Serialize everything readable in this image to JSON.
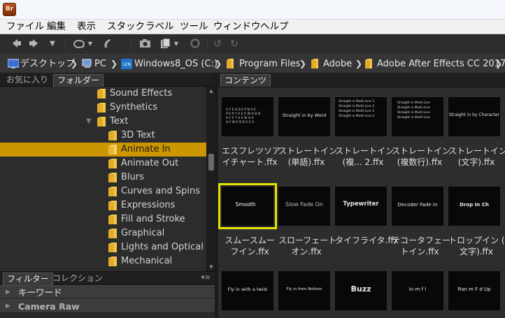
{
  "window": {
    "app_icon_label": "Br"
  },
  "menu": [
    "ファイル",
    "編集",
    "表示",
    "スタック",
    "ラベル",
    "ツール",
    "ウィンドウ",
    "ヘルプ"
  ],
  "path": {
    "items": [
      "デスクトップ",
      "PC",
      "Windows8_OS (C:)",
      "Program Files",
      "Adobe",
      "Adobe After Effects CC 2017"
    ],
    "drive_icon_label": "LEN"
  },
  "left_tabs": {
    "favorites": "お気に入り",
    "folders": "フォルダー"
  },
  "tree": [
    {
      "label": "Sound Effects"
    },
    {
      "label": "Synthetics"
    },
    {
      "label": "Text",
      "expanded": true
    },
    {
      "label": "3D Text"
    },
    {
      "label": "Animate In",
      "selected": true
    },
    {
      "label": "Animate Out"
    },
    {
      "label": "Blurs"
    },
    {
      "label": "Curves and Spins"
    },
    {
      "label": "Expressions"
    },
    {
      "label": "Fill and Stroke"
    },
    {
      "label": "Graphical"
    },
    {
      "label": "Lights and Optical"
    },
    {
      "label": "Mechanical"
    }
  ],
  "bottom_tabs": {
    "filter": "フィルター",
    "collection": "コレクション"
  },
  "filter_sections": [
    "キーワード",
    "Camera Raw"
  ],
  "content_tab": "コンテンツ",
  "items": [
    {
      "caption1": "エスフレツソア",
      "caption2": "イチャート.ffx",
      "thumb_text": ""
    },
    {
      "caption1": "ストレートイン",
      "caption2": "(単語).ffx",
      "thumb_text": "Straight in by Word"
    },
    {
      "caption1": "ストレートイン",
      "caption2": "(複... 2.ffx",
      "thumb_text": ""
    },
    {
      "caption1": "ストレートイン",
      "caption2": "(複数行).ffx",
      "thumb_text": ""
    },
    {
      "caption1": "ストレートイン",
      "caption2": "(文字).ffx",
      "thumb_text": "Straight in by Character"
    },
    {
      "caption1": "スムースムー",
      "caption2": "フイン.ffx",
      "thumb_text": "Smooth",
      "selected": true
    },
    {
      "caption1": "スローフェート",
      "caption2": "オン.ffx",
      "thumb_text": "Slow Fade On"
    },
    {
      "caption1": "タイフライタ.ffx",
      "caption2": "",
      "thumb_text": "Typewriter"
    },
    {
      "caption1": "テコータフェー",
      "caption2": "トイン.ffx",
      "thumb_text": "Decoder Fade In"
    },
    {
      "caption1": "トロップイン (",
      "caption2": "文字).ffx",
      "thumb_text": "Drop In Ch"
    },
    {
      "caption1": "",
      "caption2": "",
      "thumb_text": "Fly in with a twist"
    },
    {
      "caption1": "",
      "caption2": "",
      "thumb_text": "Fly in from Bottom"
    },
    {
      "caption1": "",
      "caption2": "",
      "thumb_text": "Buzz"
    },
    {
      "caption1": "",
      "caption2": "",
      "thumb_text": "In  m    f   l"
    },
    {
      "caption1": "",
      "caption2": "",
      "thumb_text": "Ran  m F d  Up"
    }
  ],
  "thumb_lines": {
    "effect": [
      "S Y E  A D E  P  N  A  E",
      "P E R  T H E  E  W O R D",
      "S Y E  T H E  W  A  A",
      "O F  W E B  D  C E  A"
    ],
    "multiline_a": [
      "Straight in Multi-Line 2",
      "Straight in Multi-Line 2",
      "Straight in Multi-Line 2",
      "Straight in Multi-Line 2"
    ],
    "multiline_b": [
      "Straight in Multi-Line",
      "Straight in Multi-Line",
      "Straight in Multi-Line",
      "Straight in Multi-Line"
    ]
  }
}
